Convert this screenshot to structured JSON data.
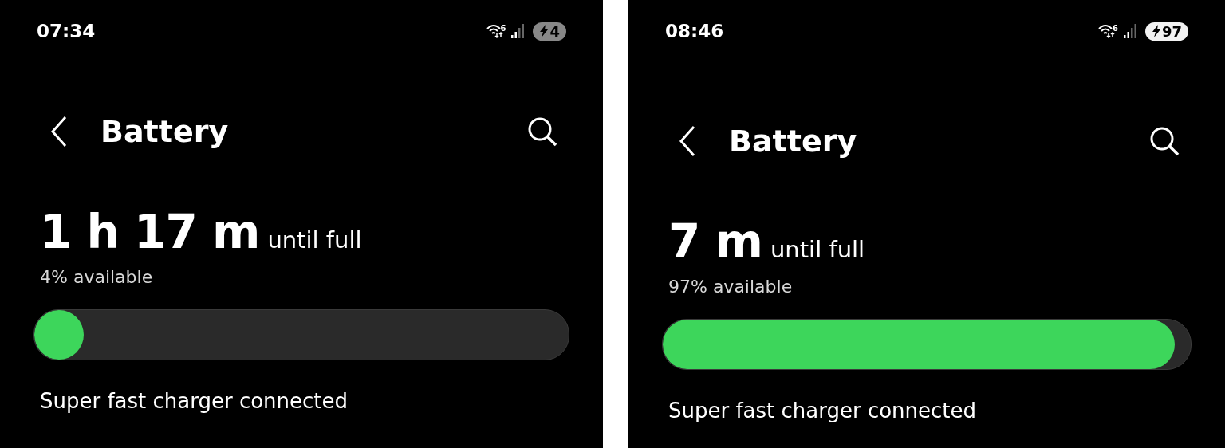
{
  "screens": [
    {
      "status_bar": {
        "time": "07:34",
        "wifi_generation": "6",
        "battery": {
          "text": "4",
          "low": true,
          "charging": true
        }
      },
      "title": "Battery",
      "remaining": {
        "value": "1 h 17 m",
        "suffix": "until full"
      },
      "available": "4% available",
      "charge_bar": {
        "level": 0.04
      },
      "charger_status": "Super fast charger connected"
    },
    {
      "status_bar": {
        "time": "08:46",
        "wifi_generation": "6",
        "battery": {
          "text": "97",
          "low": false,
          "charging": true
        }
      },
      "title": "Battery",
      "remaining": {
        "value": "7 m",
        "suffix": "until full"
      },
      "available": "97% available",
      "charge_bar": {
        "level": 0.97
      },
      "charger_status": "Super fast charger connected"
    }
  ]
}
